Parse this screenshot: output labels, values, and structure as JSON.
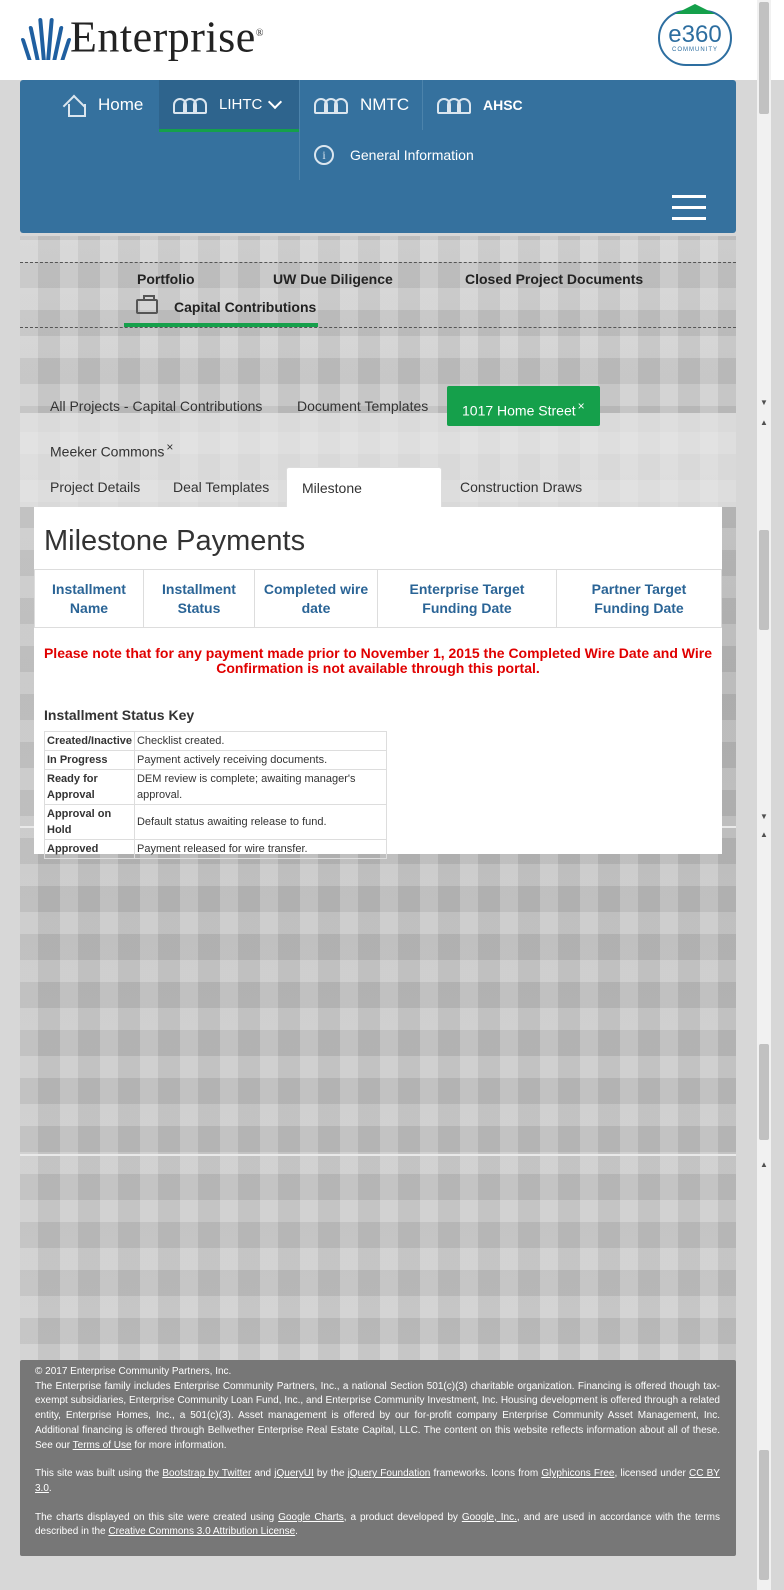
{
  "brand": {
    "name": "Enterprise",
    "registered": "®",
    "badge_main": "e360",
    "badge_sub": "COMMUNITY"
  },
  "colors": {
    "nav_blue": "#35719e",
    "accent_green": "#15a04b",
    "link_blue": "#2a6496",
    "warning_red": "#e00000",
    "footer_gray": "#777777"
  },
  "nav": {
    "items": [
      {
        "label": "Home",
        "icon": "home-icon"
      },
      {
        "label": "LIHTC",
        "icon": "people-icon"
      },
      {
        "label": "NMTC",
        "icon": "people-icon"
      },
      {
        "label": "AHSC",
        "icon": "people-icon"
      }
    ],
    "general_info": "General Information",
    "menu_icon": "hamburger-icon"
  },
  "section_tabs": {
    "portfolio": "Portfolio",
    "uw": "UW Due Diligence",
    "closed": "Closed Project Documents",
    "capital": "Capital Contributions"
  },
  "project_tabs": {
    "all": "All Projects - Capital Contributions",
    "templates": "Document Templates",
    "current": "1017 Home Street",
    "meeker": "Meeker Commons",
    "close_glyph": "×"
  },
  "sub_tabs": [
    "Project Details",
    "Deal Templates",
    "Milestone Payments",
    "Construction Draws"
  ],
  "content": {
    "title": "Milestone Payments",
    "columns": [
      "Installment Name",
      "Installment Status",
      "Completed wire date",
      "Enterprise Target Funding Date",
      "Partner Target Funding Date"
    ],
    "warning": "Please note that for any payment made prior to November 1, 2015 the Completed Wire Date and Wire Confirmation is not available through this portal.",
    "key_title": "Installment Status Key",
    "key": [
      {
        "status": "Created/Inactive",
        "desc": "Checklist created."
      },
      {
        "status": "In Progress",
        "desc": "Payment actively receiving documents."
      },
      {
        "status": "Ready for Approval",
        "desc": "DEM review is complete; awaiting manager's approval."
      },
      {
        "status": "Approval on Hold",
        "desc": "Default status awaiting release to fund."
      },
      {
        "status": "Approved",
        "desc": "Payment released for wire transfer."
      }
    ]
  },
  "footer": {
    "copyright": "© 2017 Enterprise Community Partners, Inc.",
    "p1": "The Enterprise family includes Enterprise Community Partners, Inc., a national Section 501(c)(3) charitable organization. Financing is offered though tax-exempt subsidiaries, Enterprise Community Loan Fund, Inc., and Enterprise Community Investment, Inc. Housing development is offered through a related entity, Enterprise Homes, Inc., a 501(c)(3). Asset management is offered by our for-profit company Enterprise Community Asset Management, Inc. Additional financing is offered through Bellwether Enterprise Real Estate Capital, LLC. The content on this website reflects information about all of these. See our",
    "terms": "Terms of Use",
    "p1_end": "for more information.",
    "p2_a": "This site was built using the",
    "bootstrap": "Bootstrap by Twitter",
    "and": "and",
    "jqueryui": "jQueryUI",
    "by_the": "by the",
    "jquery_foundation": "jQuery Foundation",
    "p2_b": "frameworks. Icons from",
    "glyphicons": "Glyphicons Free",
    "p2_c": ", licensed under",
    "ccby": "CC BY 3.0",
    "p2_d": ".",
    "p3_a": "The charts displayed on this site were created using",
    "google_charts": "Google Charts",
    "p3_b": ", a product developed by",
    "google": "Google, Inc.",
    "p3_c": ", and are used in accordance with the terms described in the",
    "cc_attr": "Creative Commons 3.0 Attribution License",
    "p3_d": "."
  }
}
